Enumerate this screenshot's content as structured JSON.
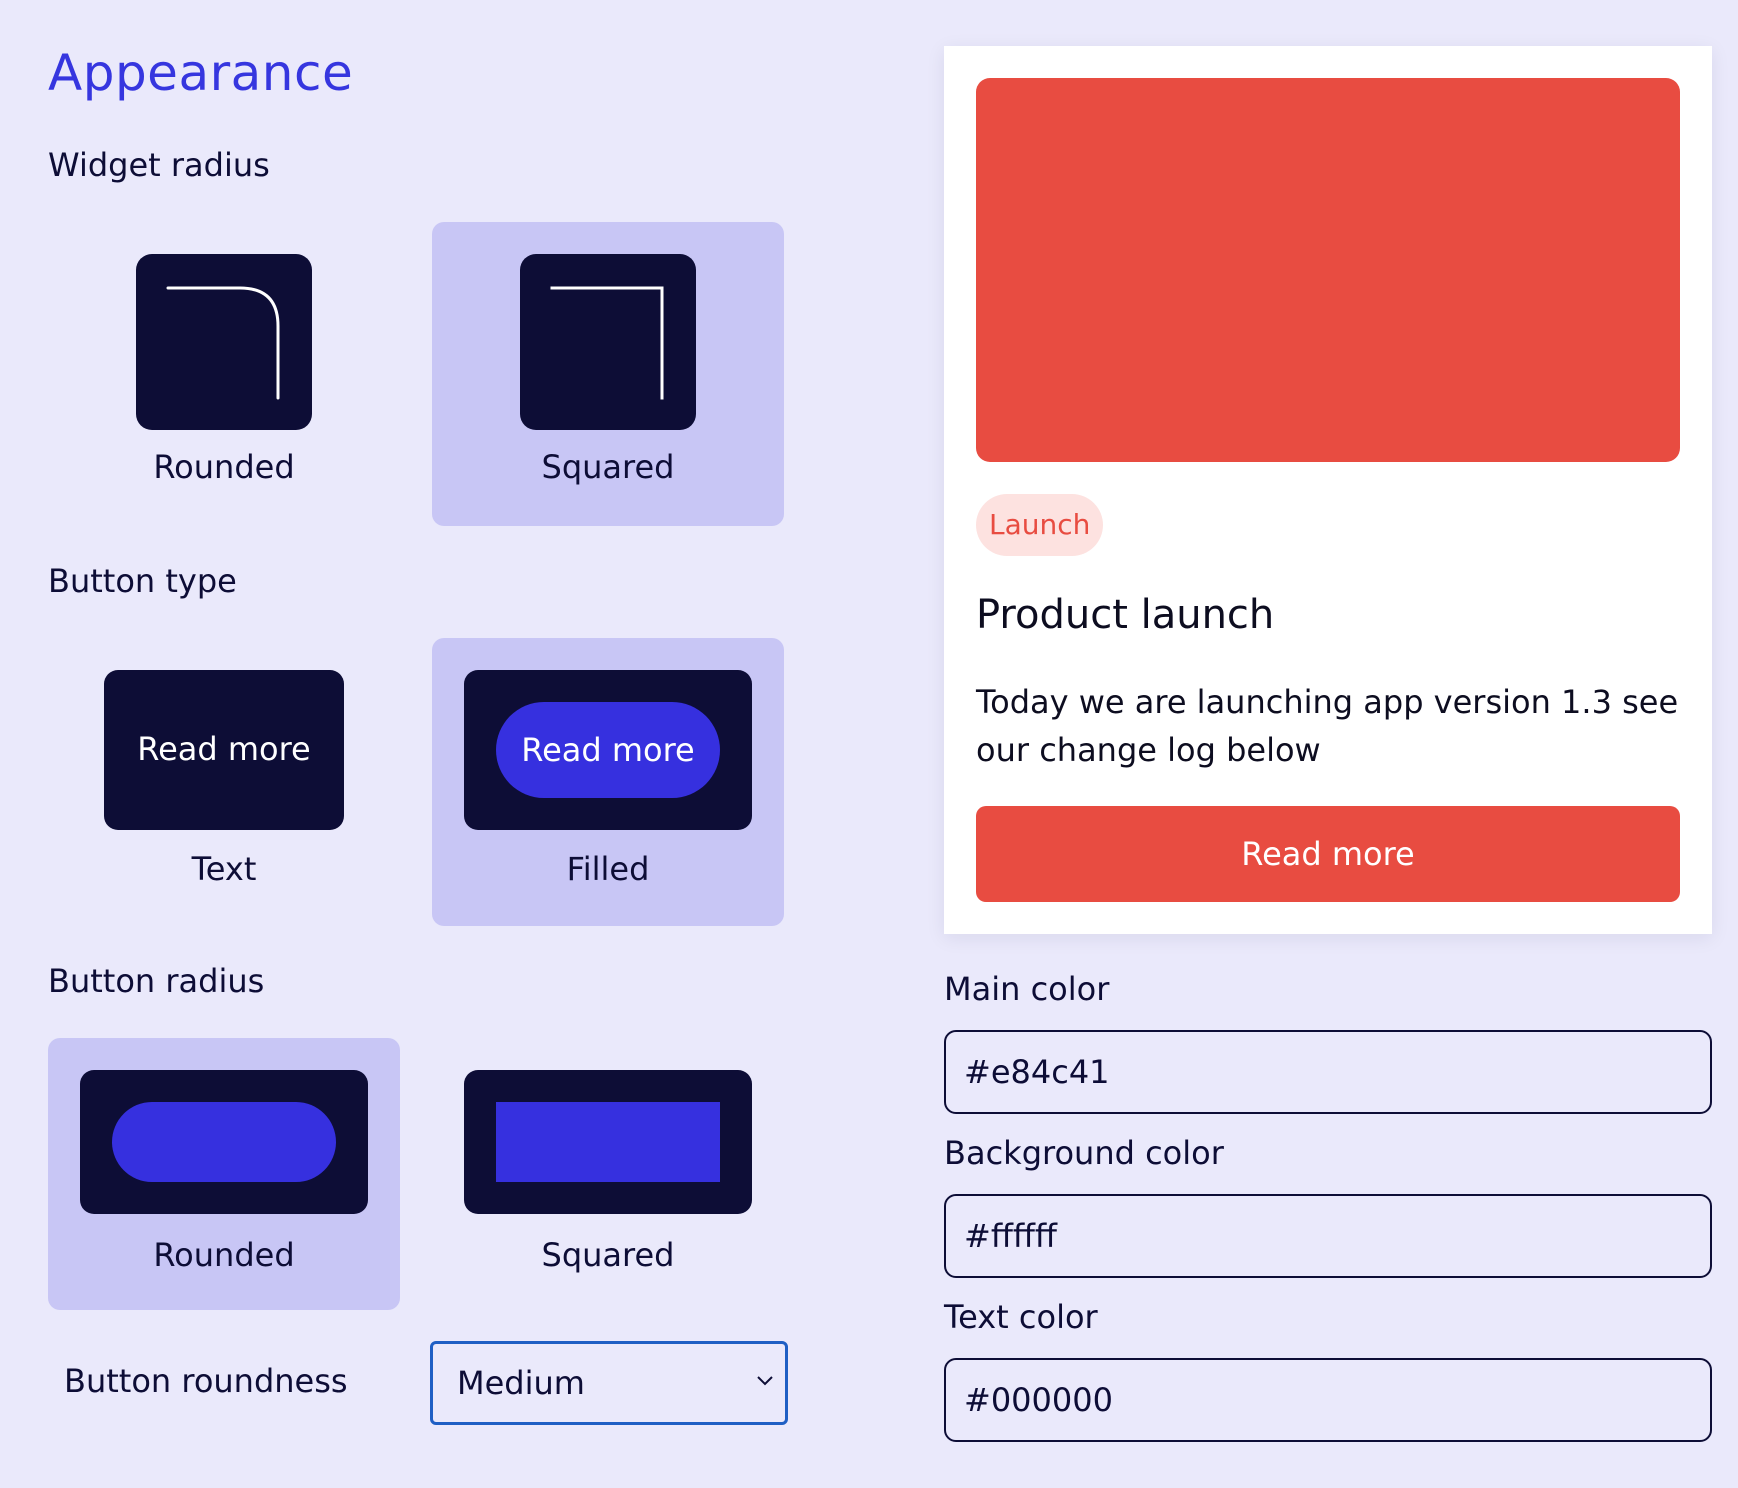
{
  "title": "Appearance",
  "widget_radius": {
    "label": "Widget radius",
    "options": [
      {
        "label": "Rounded",
        "selected": false
      },
      {
        "label": "Squared",
        "selected": true
      }
    ]
  },
  "button_type": {
    "label": "Button type",
    "demo_label": "Read more",
    "options": [
      {
        "label": "Text",
        "selected": false
      },
      {
        "label": "Filled",
        "selected": true
      }
    ]
  },
  "button_radius": {
    "label": "Button radius",
    "options": [
      {
        "label": "Rounded",
        "selected": true
      },
      {
        "label": "Squared",
        "selected": false
      }
    ]
  },
  "button_roundness": {
    "label": "Button roundness",
    "value": "Medium"
  },
  "preview": {
    "badge": "Launch",
    "title": "Product launch",
    "body": "Today we are launching app version 1.3 see our change log below",
    "button": "Read more"
  },
  "colors": {
    "main": {
      "label": "Main color",
      "value": "#e84c41"
    },
    "background": {
      "label": "Background color",
      "value": "#ffffff"
    },
    "text": {
      "label": "Text color",
      "value": "#000000"
    },
    "accent": "#3630df",
    "selected_bg": "#c8c6f5",
    "page_bg": "#eae9fb"
  }
}
